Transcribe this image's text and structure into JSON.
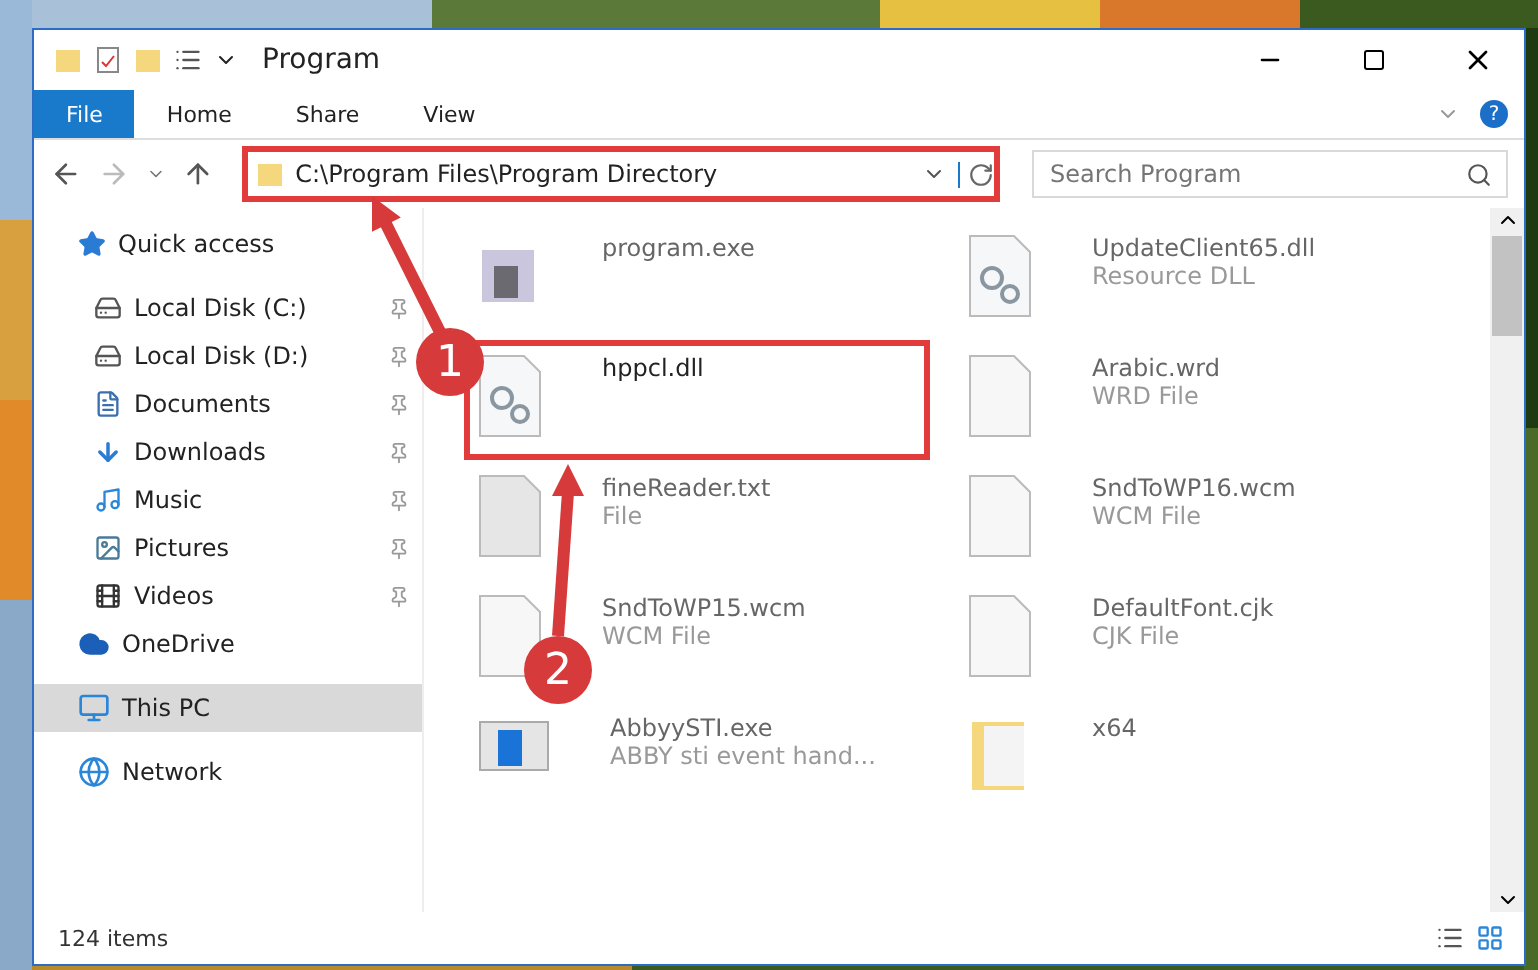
{
  "window": {
    "title": "Program"
  },
  "ribbon_tabs": [
    {
      "label": "File",
      "selected": true
    },
    {
      "label": "Home",
      "selected": false
    },
    {
      "label": "Share",
      "selected": false
    },
    {
      "label": "View",
      "selected": false
    }
  ],
  "address": {
    "path": "C:\\Program Files\\Program Directory"
  },
  "search": {
    "placeholder": "Search Program"
  },
  "sidebar": {
    "items": [
      {
        "label": "Quick access",
        "kind": "star",
        "pinned": false,
        "selected": false,
        "children": [
          {
            "label": "Local Disk (C:)",
            "kind": "disk",
            "pinned": true,
            "selected": false
          },
          {
            "label": "Local Disk (D:)",
            "kind": "disk",
            "pinned": true,
            "selected": false
          },
          {
            "label": "Documents",
            "kind": "doc",
            "pinned": true,
            "selected": false
          },
          {
            "label": "Downloads",
            "kind": "download",
            "pinned": true,
            "selected": false
          },
          {
            "label": "Music",
            "kind": "music",
            "pinned": true,
            "selected": false
          },
          {
            "label": "Pictures",
            "kind": "pictures",
            "pinned": true,
            "selected": false
          },
          {
            "label": "Videos",
            "kind": "videos",
            "pinned": true,
            "selected": false
          }
        ]
      },
      {
        "label": "OneDrive",
        "kind": "cloud",
        "pinned": false,
        "selected": false
      },
      {
        "label": "This PC",
        "kind": "pc",
        "pinned": false,
        "selected": true
      },
      {
        "label": "Network",
        "kind": "network",
        "pinned": false,
        "selected": false
      }
    ]
  },
  "files": [
    {
      "name": "program.exe",
      "kind": "exe",
      "highlighted": false
    },
    {
      "name": "UpdateClient65.dll",
      "type": "Resource DLL",
      "kind": "dll",
      "highlighted": false
    },
    {
      "name": "hppcl.dll",
      "kind": "dll",
      "highlighted": true
    },
    {
      "name": "Arabic.wrd",
      "type": "WRD File",
      "kind": "blank",
      "highlighted": false
    },
    {
      "name": "fineReader.txt",
      "type": "File",
      "kind": "gray",
      "highlighted": false
    },
    {
      "name": "SndToWP16.wcm",
      "type": "WCM File",
      "kind": "blank",
      "highlighted": false
    },
    {
      "name": "SndToWP15.wcm",
      "type": "WCM File",
      "kind": "blank",
      "highlighted": false
    },
    {
      "name": "DefaultFont.cjk",
      "type": "CJK File",
      "kind": "blank",
      "highlighted": false
    },
    {
      "name": "AbbyySTI.exe",
      "type": "ABBY sti event hand...",
      "kind": "app",
      "highlighted": false
    },
    {
      "name": "x64",
      "kind": "folder",
      "highlighted": false
    }
  ],
  "help": "?",
  "annotations": [
    "1",
    "2"
  ],
  "status_bar": {
    "count": "124 items"
  }
}
